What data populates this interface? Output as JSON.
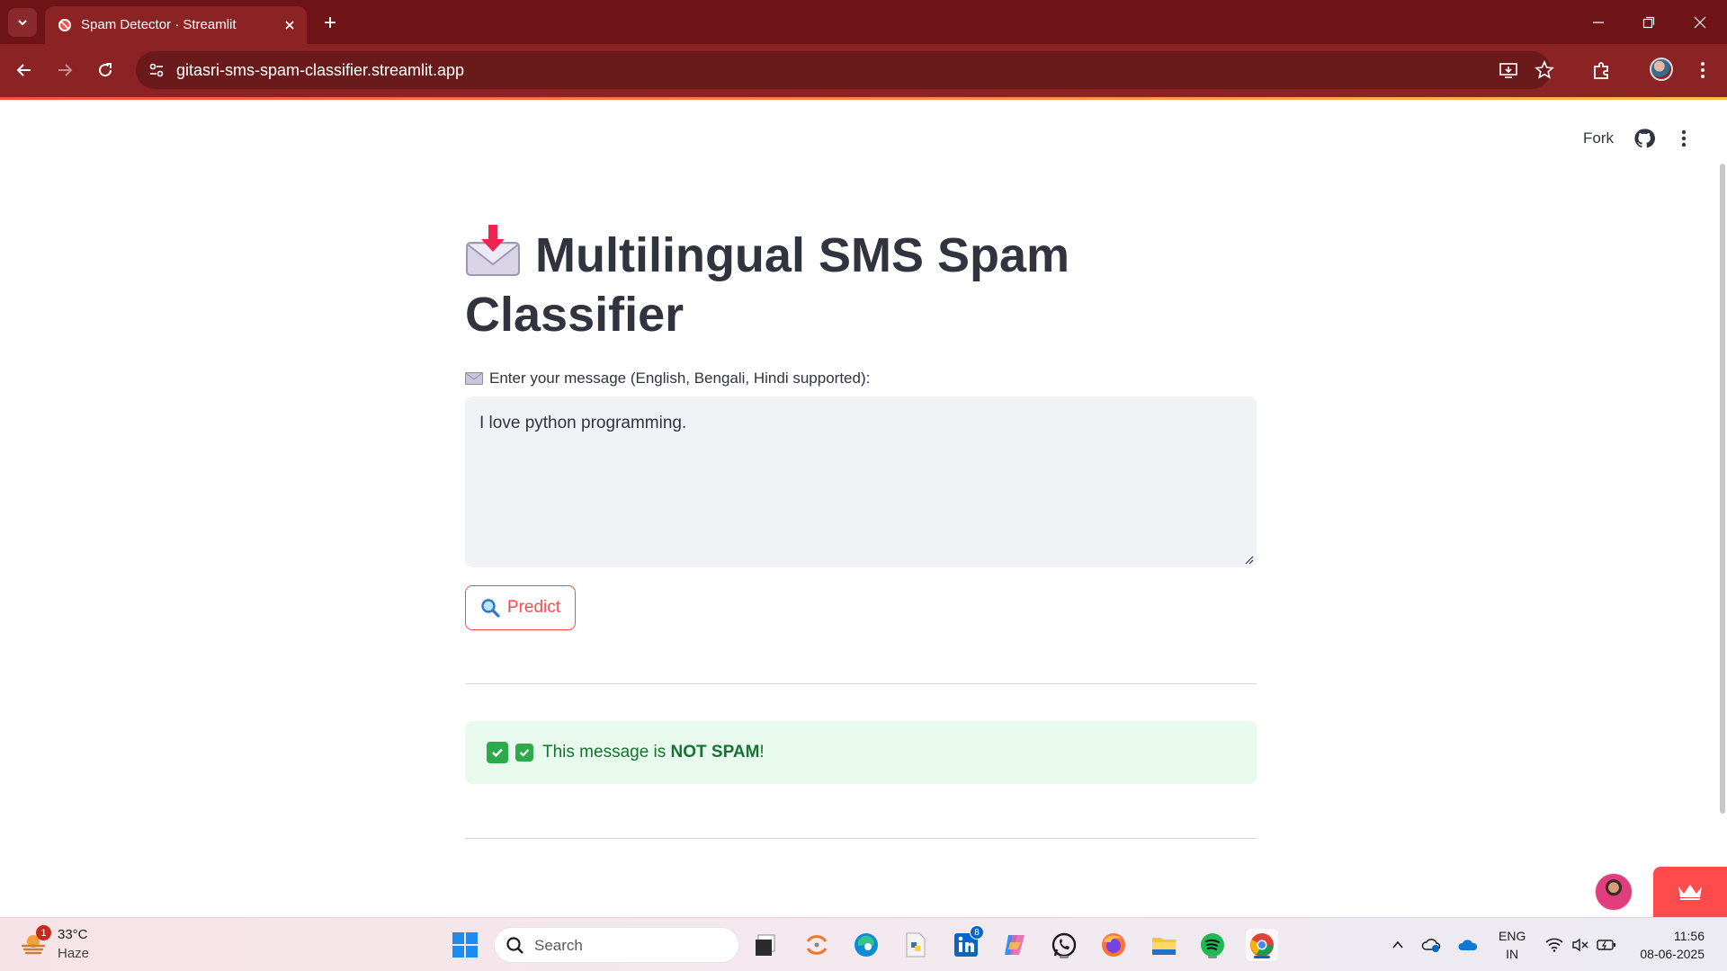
{
  "browser": {
    "tab_title": "Spam Detector · Streamlit",
    "url": "gitasri-sms-spam-classifier.streamlit.app",
    "colors": {
      "tabbar": "#6e1316",
      "toolbar": "#8b2224"
    }
  },
  "app": {
    "header": {
      "fork_label": "Fork"
    },
    "title": "Multilingual SMS Spam Classifier",
    "title_icon": "envelope-incoming-emoji",
    "input_label": "Enter your message (English, Bengali, Hindi supported):",
    "input_value": "I love python programming.",
    "predict_label": "Predict",
    "result": {
      "prefix": "This message is ",
      "verdict": "NOT SPAM",
      "suffix": "!",
      "color": "#177233",
      "background": "#e8f9ee"
    },
    "accent": "#ff4b4b"
  },
  "taskbar": {
    "weather_temp": "33°C",
    "weather_desc": "Haze",
    "weather_badge": "1",
    "search_placeholder": "Search",
    "linkedin_badge": "8",
    "language": "ENG",
    "region": "IN",
    "time": "11:56",
    "date": "08-06-2025"
  }
}
